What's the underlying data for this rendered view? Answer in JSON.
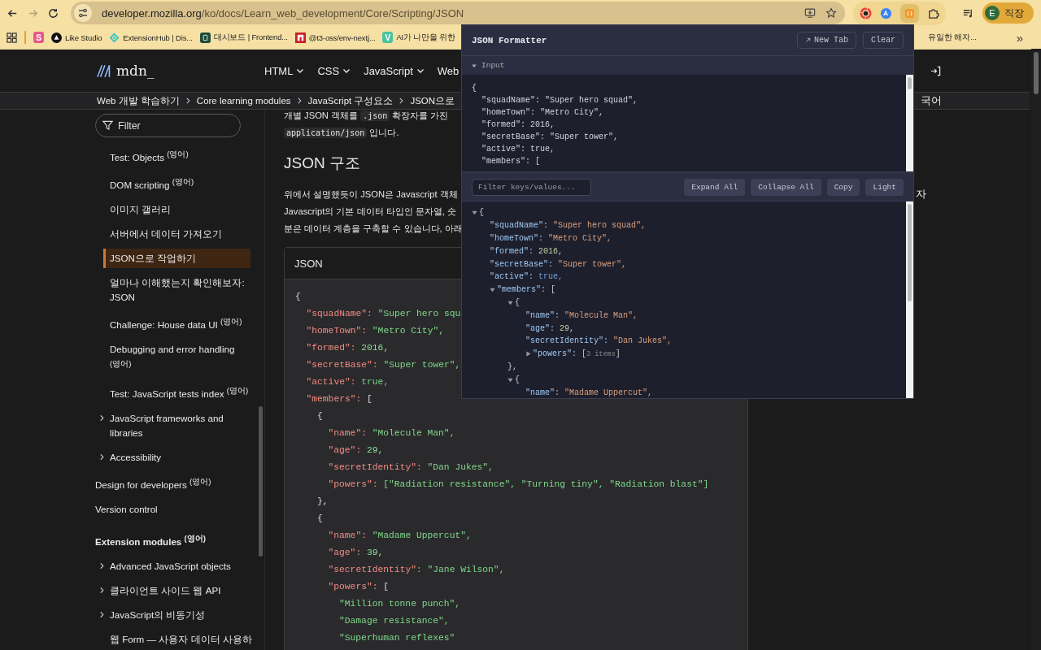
{
  "browser": {
    "url_host": "developer.mozilla.org",
    "url_path": "/ko/docs/Learn_web_development/Core/Scripting/JSON",
    "forward_disabled": true,
    "bookmarks": [
      {
        "kind": "letter",
        "badge": "S",
        "color": "#e8588a"
      },
      {
        "kind": "circle",
        "label": "Like Studio"
      },
      {
        "kind": "diamond",
        "label": "ExtensionHub | Dis..."
      },
      {
        "kind": "tile",
        "label": "대시보드 | Frontend..."
      },
      {
        "kind": "frame",
        "label": "@t3-oss/env-nextj..."
      },
      {
        "kind": "letter",
        "badge": "V",
        "color": "#4cc3a0",
        "label": "AI가 나만을 위한"
      },
      {
        "kind": "plain",
        "label": "유일한 해자..."
      }
    ],
    "more_bookmarks": "»",
    "profile": {
      "initial": "E",
      "label": "직장"
    }
  },
  "mdn": {
    "logo_text": "mdn_",
    "nav": [
      {
        "label": "HTML"
      },
      {
        "label": "CSS"
      },
      {
        "label": "JavaScript"
      },
      {
        "label": "Web"
      }
    ],
    "breadcrumbs": [
      "Web 개발 학습하기",
      "Core learning modules",
      "JavaScript 구성요소",
      "JSON으로"
    ],
    "language": "국어",
    "sidebar": {
      "filter_placeholder": "Filter",
      "continued_items": [
        {
          "label": "Test: Objects $^{(영어)}$",
          "expandable": false,
          "selected": false
        },
        {
          "label": "DOM scripting $^{(영어)}$",
          "expandable": false,
          "selected": false
        },
        {
          "label": "이미지 갤러리",
          "expandable": false,
          "selected": false
        },
        {
          "label": "서버에서 데이터 가져오기",
          "expandable": false,
          "selected": false
        },
        {
          "label": "JSON으로 작업하기",
          "expandable": false,
          "selected": true
        },
        {
          "label": "얼마나 이해했는지 확인해보자: JSON",
          "expandable": false,
          "selected": false
        },
        {
          "label": "Challenge: House data UI $^{(영어)}$",
          "expandable": false,
          "selected": false
        },
        {
          "label": "Debugging and error handling $^{(영어)}$",
          "expandable": false,
          "selected": false
        },
        {
          "label": "Test: JavaScript tests index $^{(영어)}$",
          "expandable": false,
          "selected": false
        },
        {
          "label": "JavaScript frameworks and libraries",
          "expandable": true,
          "selected": false
        },
        {
          "label": "Accessibility",
          "expandable": true,
          "selected": false
        }
      ],
      "items": [
        {
          "label": "Design for developers $^{(영어)}$",
          "kind": "link",
          "selected": false
        },
        {
          "label": "Version control",
          "kind": "link",
          "selected": false
        },
        {
          "label": "Extension modules $^{(영어)}$",
          "kind": "heading",
          "selected": false,
          "children": [
            {
              "label": "Advanced JavaScript objects",
              "expandable": true,
              "selected": false
            },
            {
              "label": "클라이언트 사이드 웹 API",
              "expandable": true,
              "selected": false
            },
            {
              "label": "JavaScript의 비동기성",
              "expandable": true,
              "selected": false
            },
            {
              "label": "웹 Form — 사용자 데이터 사용하",
              "expandable": false,
              "selected": false
            }
          ]
        }
      ]
    },
    "intro": [
      [
        {
          "kind": "text",
          "text": "개별 JSON 객체를 "
        },
        {
          "kind": "code",
          "text": ".json"
        },
        {
          "kind": "text",
          "text": " 확장자를 가진"
        }
      ],
      [
        {
          "kind": "code",
          "text": "application/json"
        },
        {
          "kind": "text",
          "text": " 입니다."
        }
      ]
    ],
    "heading": "JSON 구조",
    "paragraph_lines": [
      "위에서 설명했듯이 JSON은 Javascript 객체",
      "Javascript의 기본 데이터 타입인 문자열, 숫",
      "분은 데이터 계층을 구축할 수 있습니다, 아래"
    ],
    "paragraph_tail": "자",
    "code_title": "JSON",
    "code": {
      "open": "{",
      "children": [
        {
          "key": "\"squadName\":",
          "value": "\"Super hero squ",
          "kind": "string"
        },
        {
          "key": "\"homeTown\":",
          "value": "\"Metro City\",",
          "kind": "string"
        },
        {
          "key": "\"formed\":",
          "value": "2016,",
          "kind": "number"
        },
        {
          "key": "\"secretBase\":",
          "value": "\"Super tower\",",
          "kind": "string"
        },
        {
          "key": "\"active\":",
          "value": "true,",
          "kind": "boolean"
        },
        {
          "key": "\"members\":",
          "open": "[",
          "children": [
            {
              "open": "{",
              "close": "},",
              "children": [
                {
                  "key": "\"name\":",
                  "value": "\"Molecule Man\",",
                  "kind": "string"
                },
                {
                  "key": "\"age\":",
                  "value": "29,",
                  "kind": "number"
                },
                {
                  "key": "\"secretIdentity\":",
                  "value": "\"Dan Jukes\",",
                  "kind": "string"
                },
                {
                  "key": "\"powers\":",
                  "value": "[\"Radiation resistance\", \"Turning tiny\", \"Radiation blast\"]",
                  "kind": "string"
                }
              ]
            },
            {
              "open": "{",
              "children": [
                {
                  "key": "\"name\":",
                  "value": "\"Madame Uppercut\",",
                  "kind": "string"
                },
                {
                  "key": "\"age\":",
                  "value": "39,",
                  "kind": "number"
                },
                {
                  "key": "\"secretIdentity\":",
                  "value": "\"Jane Wilson\",",
                  "kind": "string"
                },
                {
                  "key": "\"powers\":",
                  "open": "[",
                  "children": [
                    {
                      "value": "\"Million tonne punch\",",
                      "kind": "string"
                    },
                    {
                      "value": "\"Damage resistance\",",
                      "kind": "string"
                    },
                    {
                      "value": "\"Superhuman reflexes\"",
                      "kind": "string"
                    }
                  ]
                }
              ]
            }
          ]
        }
      ]
    }
  },
  "formatter": {
    "title": "JSON Formatter",
    "new_tab": "New Tab",
    "clear": "Clear",
    "input_section": {
      "label": "Input",
      "expanded": true
    },
    "input_text": "{\n  \"squadName\": \"Super hero squad\",\n  \"homeTown\": \"Metro City\",\n  \"formed\": 2016,\n  \"secretBase\": \"Super tower\",\n  \"active\": true,\n  \"members\": [",
    "filter_placeholder": "Filter keys/values...",
    "buttons": [
      "Expand All",
      "Collapse All",
      "Copy",
      "Light"
    ],
    "tree": {
      "open": "{",
      "expanded": true,
      "children": [
        {
          "key": "\"squadName\":",
          "value": "\"Super hero squad\",",
          "kind": "string"
        },
        {
          "key": "\"homeTown\":",
          "value": "\"Metro City\",",
          "kind": "string"
        },
        {
          "key": "\"formed\":",
          "value": "2016,",
          "kind": "number"
        },
        {
          "key": "\"secretBase\":",
          "value": "\"Super tower\",",
          "kind": "string"
        },
        {
          "key": "\"active\":",
          "value": "true,",
          "kind": "boolean"
        },
        {
          "key": "\"members\":",
          "open": "[",
          "expanded": true,
          "children": [
            {
              "open": "{",
              "expanded": true,
              "close": "},",
              "children": [
                {
                  "key": "\"name\":",
                  "value": "\"Molecule Man\",",
                  "kind": "string"
                },
                {
                  "key": "\"age\":",
                  "value": "29,",
                  "kind": "number"
                },
                {
                  "key": "\"secretIdentity\":",
                  "value": "\"Dan Jukes\",",
                  "kind": "string"
                },
                {
                  "key": "\"powers\":",
                  "open": "[",
                  "expanded": false,
                  "summary": "3 items",
                  "close": "]"
                }
              ]
            },
            {
              "open": "{",
              "expanded": true,
              "children": [
                {
                  "key": "\"name\":",
                  "value": "\"Madame Uppercut\",",
                  "kind": "string"
                }
              ]
            }
          ]
        }
      ]
    }
  }
}
